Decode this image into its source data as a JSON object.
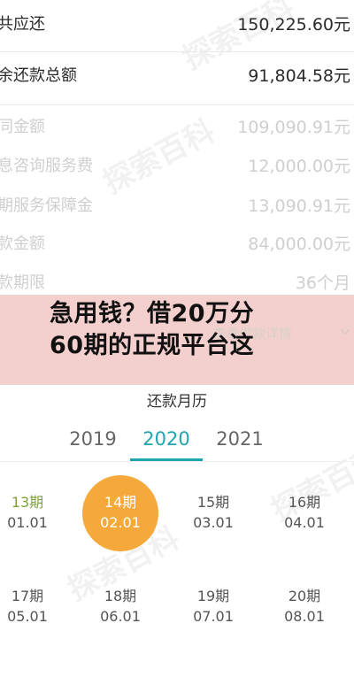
{
  "summary": {
    "rows": [
      {
        "label": "共应还",
        "value": "150,225.60元"
      },
      {
        "label": "余还款总额",
        "value": "91,804.58元"
      },
      {
        "label": "同金额",
        "value": "109,090.91元"
      },
      {
        "label": "息咨询服务费",
        "value": "12,000.00元"
      },
      {
        "label": "期服务保障金",
        "value": "13,090.91元"
      },
      {
        "label": "款金额",
        "value": "84,000.00元"
      },
      {
        "label": "款期限",
        "value": "36个月"
      }
    ],
    "detail_link": "查看借款详情"
  },
  "banner": {
    "line1": "急用钱？借20万分",
    "line2": "60期的正规平台这"
  },
  "calendar": {
    "title": "还款月历",
    "years": [
      "2019",
      "2020",
      "2021"
    ],
    "selected_year": "2020",
    "cells": [
      {
        "period": "13期",
        "date": "01.01"
      },
      {
        "period": "14期",
        "date": "02.01"
      },
      {
        "period": "15期",
        "date": "03.01"
      },
      {
        "period": "16期",
        "date": "04.01"
      },
      {
        "period": "17期",
        "date": "05.01"
      },
      {
        "period": "18期",
        "date": "06.01"
      },
      {
        "period": "19期",
        "date": "07.01"
      },
      {
        "period": "20期",
        "date": "08.01"
      }
    ]
  },
  "watermark": "探索百科",
  "colors": {
    "accent": "#1fa5ad",
    "current_period": "#f5a93a",
    "paid_period": "#7fa33a",
    "banner_bg": "#f3cfcd"
  }
}
